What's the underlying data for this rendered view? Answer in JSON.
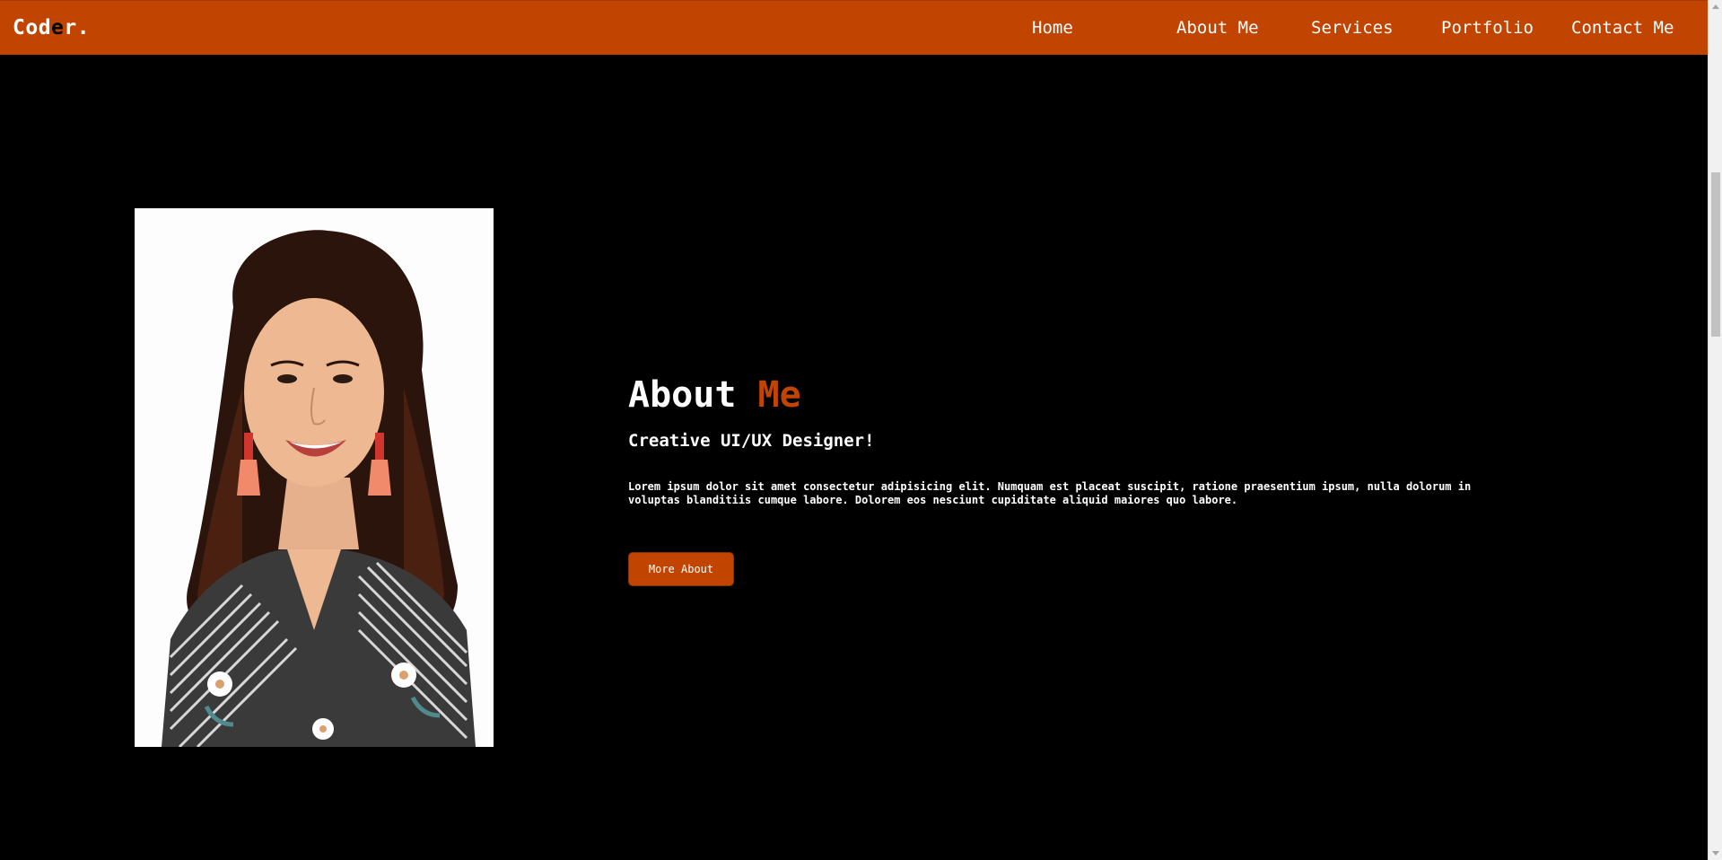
{
  "header": {
    "logo_part1": "Cod",
    "logo_accent": "e",
    "logo_part2": "r.",
    "nav": [
      "Home",
      "About Me",
      "Services",
      "Portfolio",
      "Contact Me"
    ]
  },
  "about": {
    "title_main": "About",
    "title_accent": "Me",
    "subtitle": "Creative UI/UX Designer!",
    "description": "Lorem ipsum dolor sit amet consectetur adipisicing elit. Numquam est placeat suscipit, ratione praesentium ipsum, nulla dolorum in voluptas blanditiis cumque labore. Dolorem eos nesciunt cupiditate aliquid maiores quo labore.",
    "button_label": "More About"
  },
  "colors": {
    "brand": "#c14400",
    "background": "#000000",
    "text": "#ffffff"
  },
  "scrollbar": {
    "scroll_position_fraction": 0.2
  }
}
